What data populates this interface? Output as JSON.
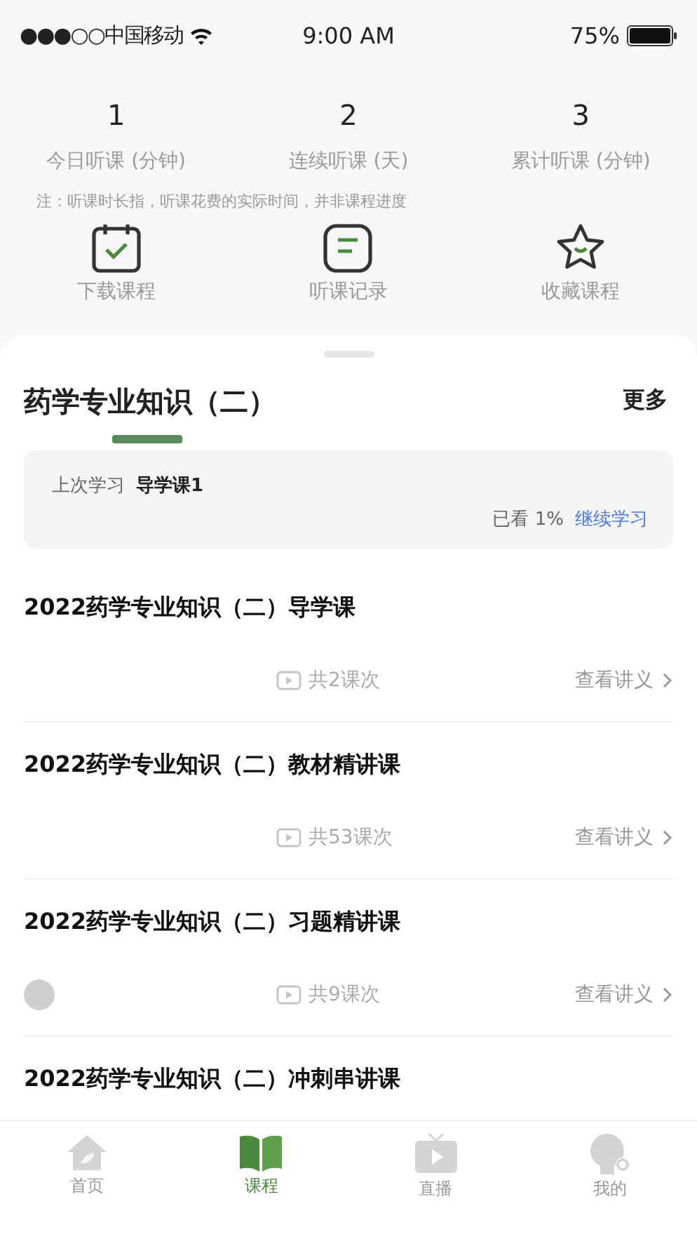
{
  "status_bar": {
    "carrier": "●●●○○中国移动",
    "time": "9:00 AM",
    "battery": "75%"
  },
  "stats": [
    {
      "value": "1",
      "label": "今日听课 (分钟)"
    },
    {
      "value": "2",
      "label": "连续听课 (天)"
    },
    {
      "value": "3",
      "label": "累计听课 (分钟)"
    }
  ],
  "note": "注：听课时长指，听课花费的实际时间，并非课程进度",
  "shortcuts": [
    {
      "kind": "calendar",
      "label": "下载课程"
    },
    {
      "kind": "note",
      "label": "听课记录"
    },
    {
      "kind": "star",
      "label": "收藏课程"
    }
  ],
  "section": {
    "title": "药学专业知识（二）",
    "more": "更多"
  },
  "last_study": {
    "label": "上次学习",
    "lesson": "导学课1",
    "progress": "已看 1%",
    "action": "继续学习"
  },
  "courses": [
    {
      "title": "2022药学专业知识（二）导学课",
      "count": "共2课次",
      "notes": "查看讲义",
      "badge": false
    },
    {
      "title": "2022药学专业知识（二）教材精讲课",
      "count": "共53课次",
      "notes": "查看讲义",
      "badge": false
    },
    {
      "title": "2022药学专业知识（二）习题精讲课",
      "count": "共9课次",
      "notes": "查看讲义",
      "badge": true
    },
    {
      "title": "2022药学专业知识（二）冲刺串讲课"
    }
  ],
  "tabs": [
    {
      "kind": "home",
      "label": "首页",
      "selected": false
    },
    {
      "kind": "book",
      "label": "课程",
      "selected": true
    },
    {
      "kind": "tv",
      "label": "直播",
      "selected": false
    },
    {
      "kind": "user",
      "label": "我的",
      "selected": false
    }
  ]
}
